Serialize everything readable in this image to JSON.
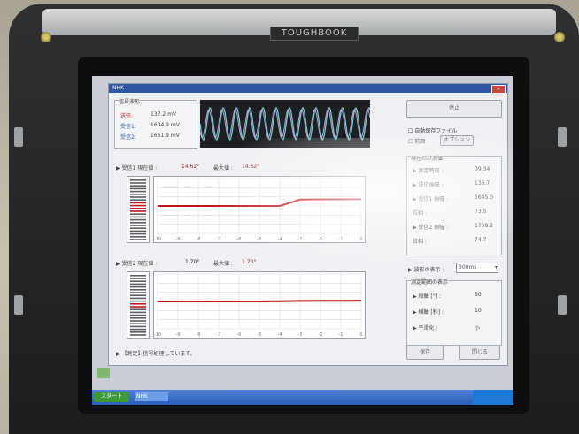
{
  "device": {
    "brand": "TOUGHBOOK"
  },
  "window": {
    "title": "NHK",
    "signal_strength": {
      "title": "信号波形",
      "transmit_label": "送信:",
      "transmit_value": "137.2 mV",
      "receive1_label": "受信1:",
      "receive1_value": "1604.9 mV",
      "receive2_label": "受信2:",
      "receive2_value": "1661.9 mV"
    },
    "panel1": {
      "header": "▶ 受信1 現在値 :",
      "current": "14.62°",
      "max_label": "最大値 :",
      "max": "14.62°"
    },
    "panel2": {
      "header": "▶ 受信2 現在値 :",
      "current": "1.70°",
      "max_label": "最大値 :",
      "max": "1.70°"
    },
    "stop_button": "停止",
    "checkbox1": "自動保存ファイル",
    "checkbox2": "前回",
    "option_button": "オプション",
    "measure_group": {
      "title": "現在の計測値",
      "rows": [
        {
          "label": "▶ 測定時刻 :",
          "value": "09:34"
        },
        {
          "label": "▶ 送信振幅 :",
          "value": "136.7"
        },
        {
          "label": "▶ 受信1 振幅 :",
          "value": "1645.0"
        },
        {
          "label": "位相 :",
          "value": "73.5"
        },
        {
          "label": "▶ 受信2 振幅 :",
          "value": "1708.2"
        },
        {
          "label": "位相 :",
          "value": "74.7"
        }
      ]
    },
    "display_range_label": "▶ 波形の表示 :",
    "display_range_value": "300ms",
    "scale_group": {
      "title": "測定範囲の表示",
      "rows": [
        {
          "label": "▶ 縦軸 [°] :",
          "value": "60"
        },
        {
          "label": "▶ 横軸 [秒] :",
          "value": "10"
        },
        {
          "label": "▶ 平滑化 :",
          "value": "小"
        }
      ]
    },
    "status_text": "▶ 【測定】信号処理しています。",
    "button_save": "保存",
    "button_close": "閉じる"
  },
  "taskbar": {
    "start_label": "スタート",
    "task_label": "NHK"
  },
  "chart_data": [
    {
      "type": "line",
      "xlabel": "",
      "ylabel": "",
      "x": [
        -10,
        -9,
        -8,
        -7,
        -6,
        -5,
        -4,
        -3,
        -2,
        -1,
        0
      ],
      "ylim": [
        -60,
        60
      ],
      "series": [
        {
          "values": [
            0,
            0,
            0,
            0,
            0,
            0,
            0,
            14,
            14.5,
            14.5,
            14.62
          ],
          "color": "#c0171a"
        }
      ]
    },
    {
      "type": "line",
      "xlabel": "",
      "ylabel": "",
      "x": [
        -10,
        -9,
        -8,
        -7,
        -6,
        -5,
        -4,
        -3,
        -2,
        -1,
        0
      ],
      "ylim": [
        -60,
        60
      ],
      "series": [
        {
          "values": [
            0,
            0,
            0,
            0,
            0,
            0,
            0.5,
            1.2,
            1.5,
            1.6,
            1.7
          ],
          "color": "#c0171a"
        }
      ]
    }
  ]
}
